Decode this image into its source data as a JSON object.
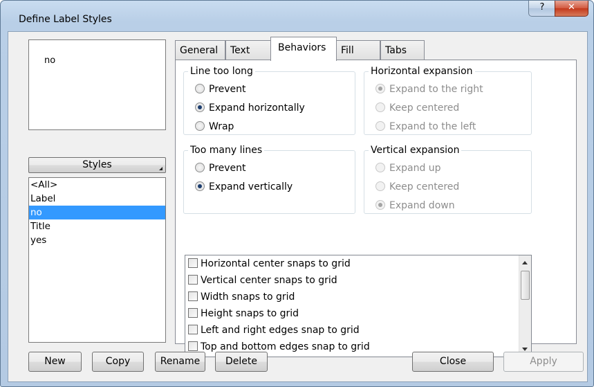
{
  "window": {
    "title": "Define Label Styles",
    "help_glyph": "?",
    "close_glyph": "✕"
  },
  "preview": {
    "text": "no"
  },
  "styles_button": {
    "label": "Styles"
  },
  "style_list": {
    "items": [
      "<All>",
      "Label",
      "no",
      "Title",
      "yes"
    ],
    "selected": "no"
  },
  "tabs": [
    {
      "label": "General"
    },
    {
      "label": "Text"
    },
    {
      "label": "Behaviors"
    },
    {
      "label": "Fill"
    },
    {
      "label": "Tabs"
    }
  ],
  "active_tab": "Behaviors",
  "groups": {
    "line_too_long": {
      "label": "Line too long",
      "options": [
        "Prevent",
        "Expand horizontally",
        "Wrap"
      ],
      "selected": "Expand horizontally"
    },
    "horizontal_expansion": {
      "label": "Horizontal expansion",
      "options": [
        "Expand to the right",
        "Keep centered",
        "Expand to the left"
      ],
      "selected": "Expand to the right",
      "enabled": false
    },
    "too_many_lines": {
      "label": "Too many lines",
      "options": [
        "Prevent",
        "Expand vertically"
      ],
      "selected": "Expand vertically"
    },
    "vertical_expansion": {
      "label": "Vertical expansion",
      "options": [
        "Expand up",
        "Keep centered",
        "Expand down"
      ],
      "selected": "Expand down",
      "enabled": false
    }
  },
  "snap_options": [
    "Horizontal center snaps to grid",
    "Vertical center snaps to grid",
    "Width snaps to grid",
    "Height snaps to grid",
    "Left and right edges snap to grid",
    "Top and bottom edges snap to grid"
  ],
  "buttons": {
    "new": "New",
    "copy": "Copy",
    "rename": "Rename",
    "delete": "Delete",
    "close": "Close",
    "apply": "Apply"
  }
}
